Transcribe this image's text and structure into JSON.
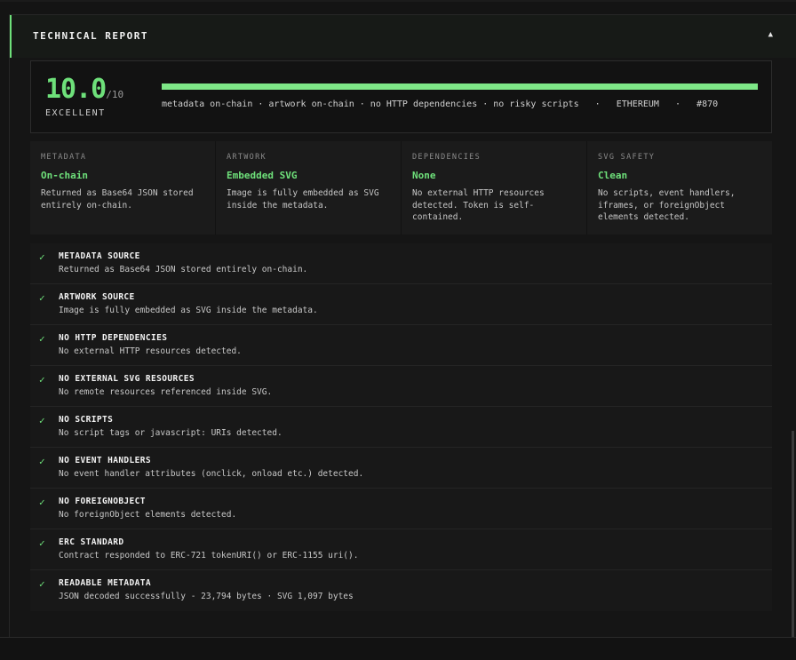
{
  "header": {
    "title": "TECHNICAL REPORT",
    "collapse_icon": "caret-up-icon"
  },
  "score": {
    "value": "10.0",
    "denominator": "/10",
    "rating": "EXCELLENT",
    "fraction": 1.0,
    "summary": "metadata on-chain · artwork on-chain · no HTTP dependencies · no risky scripts   ·   ETHEREUM   ·   #870"
  },
  "cards": [
    {
      "label": "METADATA",
      "value": "On-chain",
      "desc": "Returned as Base64 JSON stored entirely on-chain."
    },
    {
      "label": "ARTWORK",
      "value": "Embedded SVG",
      "desc": "Image is fully embedded as SVG inside the metadata."
    },
    {
      "label": "DEPENDENCIES",
      "value": "None",
      "desc": "No external HTTP resources detected. Token is self-contained."
    },
    {
      "label": "SVG SAFETY",
      "value": "Clean",
      "desc": "No scripts, event handlers, iframes, or foreignObject elements detected."
    }
  ],
  "checks": [
    {
      "icon": "✓",
      "title": "METADATA SOURCE",
      "desc": "Returned as Base64 JSON stored entirely on-chain."
    },
    {
      "icon": "✓",
      "title": "ARTWORK SOURCE",
      "desc": "Image is fully embedded as SVG inside the metadata."
    },
    {
      "icon": "✓",
      "title": "NO HTTP DEPENDENCIES",
      "desc": "No external HTTP resources detected."
    },
    {
      "icon": "✓",
      "title": "NO EXTERNAL SVG RESOURCES",
      "desc": "No remote resources referenced inside SVG."
    },
    {
      "icon": "✓",
      "title": "NO SCRIPTS",
      "desc": "No script tags or javascript: URIs detected."
    },
    {
      "icon": "✓",
      "title": "NO EVENT HANDLERS",
      "desc": "No event handler attributes (onclick, onload etc.) detected."
    },
    {
      "icon": "✓",
      "title": "NO FOREIGNOBJECT",
      "desc": "No foreignObject elements detected."
    },
    {
      "icon": "✓",
      "title": "ERC STANDARD",
      "desc": "Contract responded to ERC-721 tokenURI() or ERC-1155 uri()."
    },
    {
      "icon": "✓",
      "title": "READABLE METADATA",
      "desc": "JSON decoded successfully - 23,794 bytes · SVG 1,097 bytes"
    }
  ],
  "colors": {
    "accent": "#6ee07a",
    "background": "#141414",
    "card": "#1b1b1b"
  }
}
